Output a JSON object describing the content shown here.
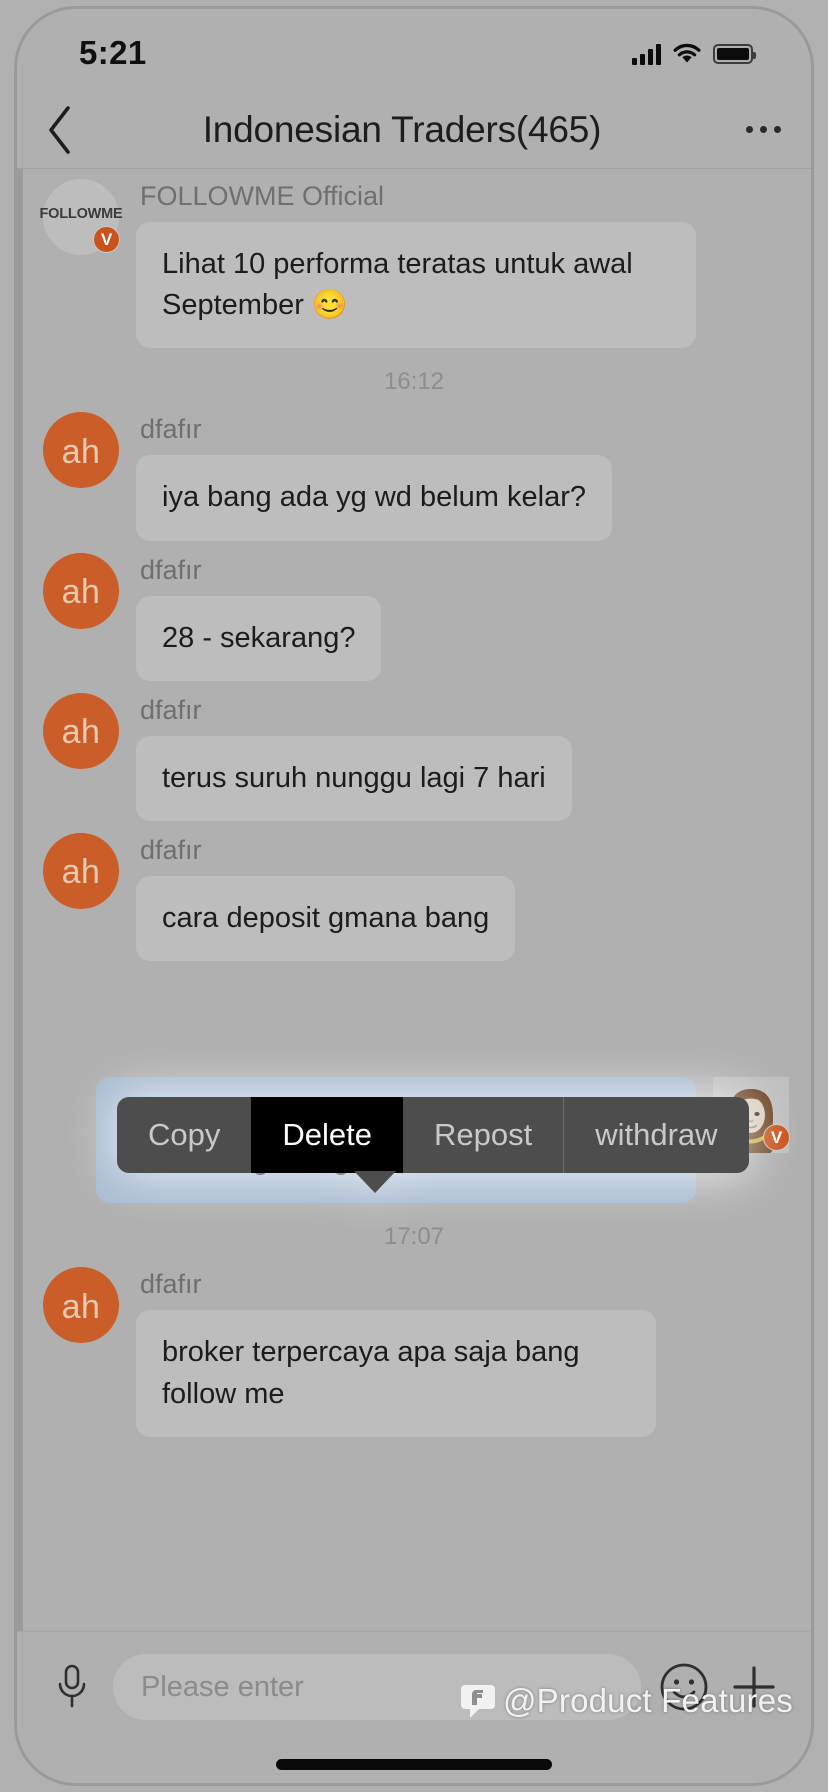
{
  "status_bar": {
    "time": "5:21",
    "signal_icon": "signal-bars-icon",
    "wifi_icon": "wifi-icon",
    "battery_icon": "battery-full-icon"
  },
  "nav": {
    "back_icon": "chevron-left-icon",
    "title": "Indonesian Traders(465)",
    "more_icon": "more-horizontal-icon"
  },
  "chat": {
    "messages": [
      {
        "id": "m1",
        "direction": "in",
        "sender": "FOLLOWME Official",
        "avatar_label": "FOLLOWME",
        "avatar_type": "official",
        "verified": "V",
        "text": "Lihat 10 performa teratas untuk awal September 😊"
      },
      {
        "id": "sep1",
        "type": "time",
        "text": "16:12"
      },
      {
        "id": "m2",
        "direction": "in",
        "sender": "dfafır",
        "avatar_label": "ah",
        "avatar_type": "initials",
        "text": "iya bang ada yg wd belum kelar?"
      },
      {
        "id": "m3",
        "direction": "in",
        "sender": "dfafır",
        "avatar_label": "ah",
        "avatar_type": "initials",
        "text": "28  - sekarang?"
      },
      {
        "id": "m4",
        "direction": "in",
        "sender": "dfafır",
        "avatar_label": "ah",
        "avatar_type": "initials",
        "text": "terus suruh nunggu lagi 7 hari"
      },
      {
        "id": "m5",
        "direction": "in",
        "sender": "dfafır",
        "avatar_label": "ah",
        "avatar_type": "initials",
        "text": "cara deposit gmana bang"
      },
      {
        "id": "m6",
        "direction": "out",
        "sender": "",
        "avatar_label": "woman-avatar",
        "avatar_type": "photo",
        "verified": "V",
        "text": "Please kindly contact to your selected brokers regarding withdrawal issue~"
      },
      {
        "id": "sep2",
        "type": "time",
        "text": "17:07"
      },
      {
        "id": "m7",
        "direction": "in",
        "sender": "dfafır",
        "avatar_label": "ah",
        "avatar_type": "initials",
        "text": "broker terpercaya apa saja bang follow me"
      }
    ]
  },
  "context_menu": {
    "items": [
      {
        "label": "Copy",
        "active": false
      },
      {
        "label": "Delete",
        "active": true
      },
      {
        "label": "Repost",
        "active": false
      },
      {
        "label": "withdraw",
        "active": false
      }
    ]
  },
  "input_bar": {
    "mic_icon": "microphone-icon",
    "placeholder": "Please enter",
    "value": "",
    "emoji_icon": "smiley-face-icon",
    "plus_icon": "plus-icon"
  },
  "watermark": {
    "logo_icon": "followme-f-logo-icon",
    "text": "@Product Features"
  },
  "colors": {
    "accent_orange": "#cb5e28",
    "badge_orange": "#c9521d",
    "bubble_in": "#bdbdbd",
    "bubble_out": "#a8bcd2",
    "menu_bg": "#4d4d4d",
    "menu_active": "#000000",
    "screen_bg": "#b0b0b0"
  }
}
